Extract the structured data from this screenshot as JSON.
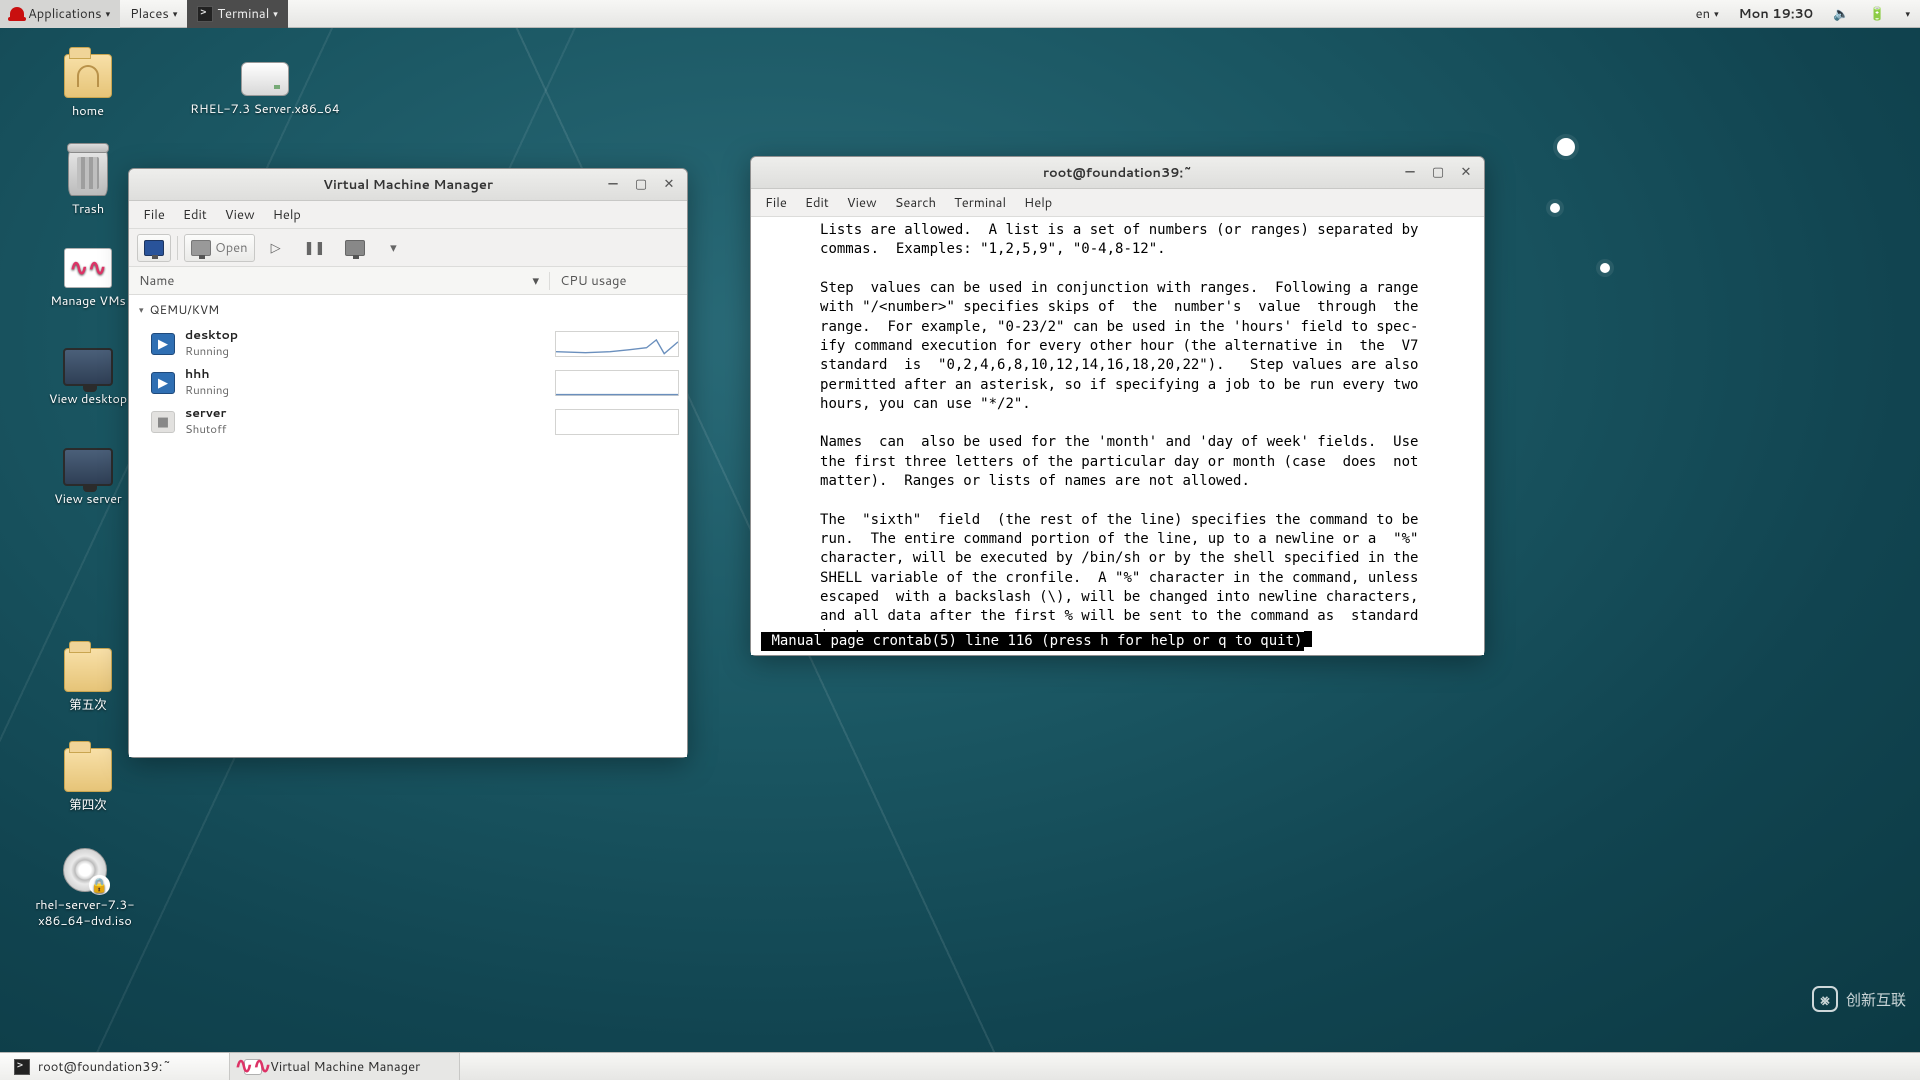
{
  "top_panel": {
    "applications": "Applications",
    "places": "Places",
    "terminal": "Terminal",
    "lang": "en",
    "clock": "Mon 19:30"
  },
  "desktop_icons": {
    "home": "home",
    "rhel_drive": "RHEL-7.3 Server.x86_64",
    "trash": "Trash",
    "manage_vms": "Manage VMs",
    "view_desktop": "View desktop",
    "view_server": "View server",
    "folder5": "第五次",
    "folder4": "第四次",
    "iso": "rhel-server-7.3-x86_64-dvd.iso"
  },
  "vmm": {
    "title": "Virtual Machine Manager",
    "menus": {
      "file": "File",
      "edit": "Edit",
      "view": "View",
      "help": "Help"
    },
    "open": "Open",
    "cols": {
      "name": "Name",
      "cpu": "CPU usage"
    },
    "connection": "QEMU/KVM",
    "vms": [
      {
        "name": "desktop",
        "state": "Running",
        "running": true
      },
      {
        "name": "hhh",
        "state": "Running",
        "running": true
      },
      {
        "name": "server",
        "state": "Shutoff",
        "running": false
      }
    ]
  },
  "terminal": {
    "title": "root@foundation39:~",
    "menus": {
      "file": "File",
      "edit": "Edit",
      "view": "View",
      "search": "Search",
      "terminal": "Terminal",
      "help": "Help"
    },
    "body": "       Lists are allowed.  A list is a set of numbers (or ranges) separated by\n       commas.  Examples: \"1,2,5,9\", \"0-4,8-12\".\n\n       Step  values can be used in conjunction with ranges.  Following a range\n       with \"/<number>\" specifies skips of  the  number's  value  through  the\n       range.  For example, \"0-23/2\" can be used in the 'hours' field to spec-\n       ify command execution for every other hour (the alternative in  the  V7\n       standard  is  \"0,2,4,6,8,10,12,14,16,18,20,22\").   Step values are also\n       permitted after an asterisk, so if specifying a job to be run every two\n       hours, you can use \"*/2\".\n\n       Names  can  also be used for the 'month' and 'day of week' fields.  Use\n       the first three letters of the particular day or month (case  does  not\n       matter).  Ranges or lists of names are not allowed.\n\n       The  \"sixth\"  field  (the rest of the line) specifies the command to be\n       run.  The entire command portion of the line, up to a newline or a  \"%\"\n       character, will be executed by /bin/sh or by the shell specified in the\n       SHELL variable of the cronfile.  A \"%\" character in the command, unless\n       escaped  with a backslash (\\), will be changed into newline characters,\n       and all data after the first % will be sent to the command as  standard\n       input.\n",
    "status": " Manual page crontab(5) line 116 (press h for help or q to quit)"
  },
  "bottom_panel": {
    "task_terminal": "root@foundation39:~",
    "task_vmm": "Virtual Machine Manager"
  },
  "watermark": "创新互联"
}
